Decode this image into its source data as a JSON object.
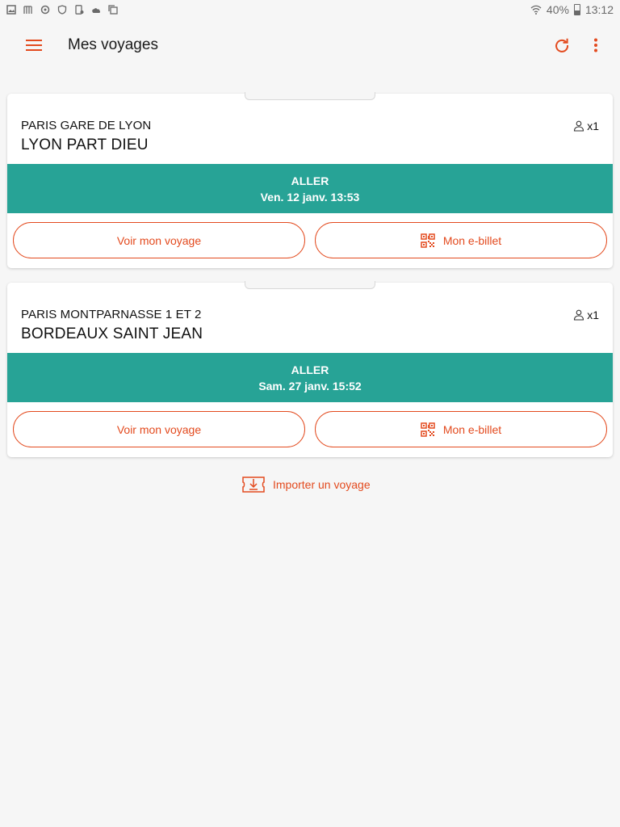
{
  "status_bar": {
    "icons": [
      "image-icon",
      "notification-icon",
      "sync-icon",
      "shield-icon",
      "phone-icon",
      "cloud-icon",
      "copy-icon"
    ],
    "battery": "40%",
    "time": "13:12"
  },
  "appbar": {
    "title": "Mes voyages",
    "menu_icon": "hamburger-icon",
    "refresh_icon": "refresh-icon",
    "more_icon": "more-vert-icon"
  },
  "trips": [
    {
      "origin": "PARIS GARE DE LYON",
      "destination": "LYON PART DIEU",
      "passengers": "x1",
      "direction": "ALLER",
      "date": "Ven. 12 janv. 13:53",
      "view_label": "Voir mon voyage",
      "ticket_label": "Mon e-billet"
    },
    {
      "origin": "PARIS MONTPARNASSE 1 ET 2",
      "destination": "BORDEAUX SAINT JEAN",
      "passengers": "x1",
      "direction": "ALLER",
      "date": "Sam. 27 janv. 15:52",
      "view_label": "Voir mon voyage",
      "ticket_label": "Mon e-billet"
    }
  ],
  "import_label": "Importer un voyage",
  "colors": {
    "accent": "#e34a1e",
    "band": "#27a396",
    "background": "#f6f6f6"
  }
}
